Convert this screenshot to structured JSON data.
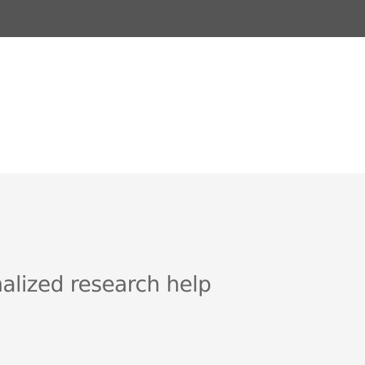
{
  "colors": {
    "topbar": "#555555",
    "content_background": "#ffffff",
    "section_background": "#f5f5f5",
    "text": "#666666"
  },
  "section": {
    "text": "nalized research help"
  }
}
